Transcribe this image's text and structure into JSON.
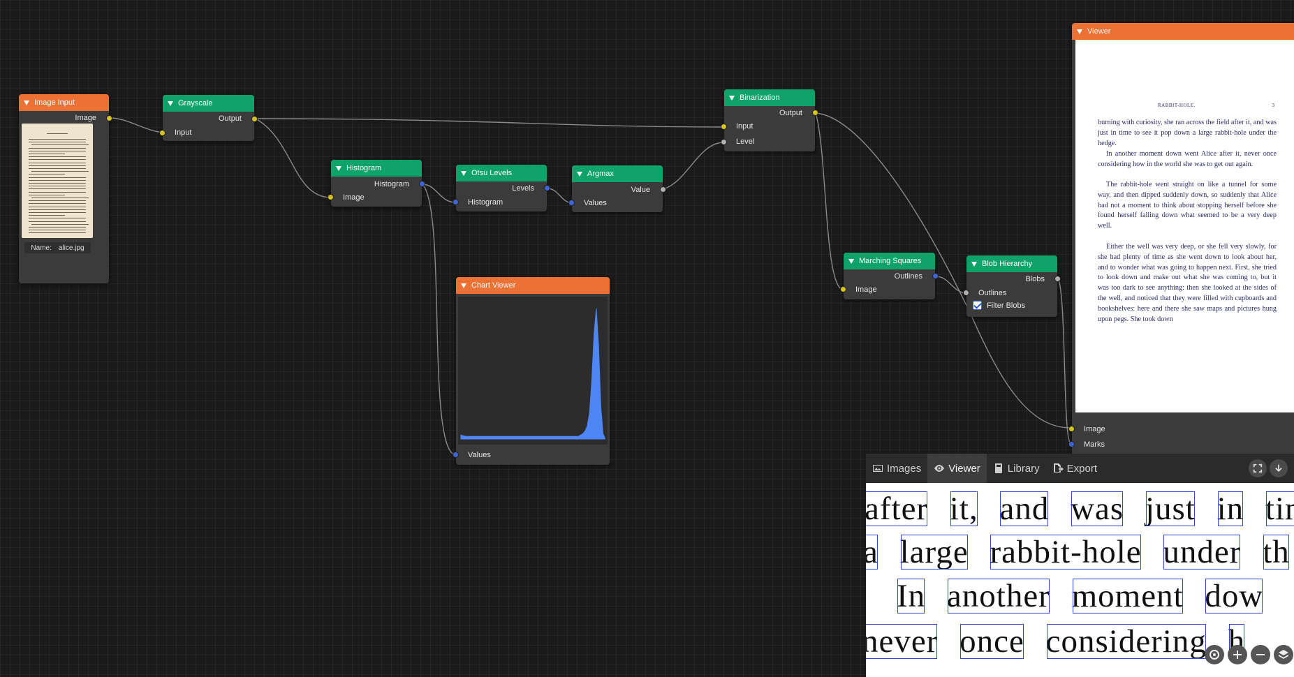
{
  "nodes": {
    "image_input": {
      "title": "Image Input",
      "output_label": "Image",
      "name_label": "Name:",
      "name_value": "alice.jpg"
    },
    "grayscale": {
      "title": "Grayscale",
      "output_label": "Output",
      "input_label": "Input"
    },
    "histogram": {
      "title": "Histogram",
      "output_label": "Histogram",
      "input_label": "Image"
    },
    "otsu": {
      "title": "Otsu Levels",
      "output_label": "Levels",
      "input_label": "Histogram"
    },
    "argmax": {
      "title": "Argmax",
      "output_label": "Value",
      "input_label": "Values"
    },
    "binarization": {
      "title": "Binarization",
      "output_label": "Output",
      "input_label": "Input",
      "level_label": "Level"
    },
    "chart_viewer": {
      "title": "Chart Viewer",
      "input_label": "Values"
    },
    "marching_squares": {
      "title": "Marching Squares",
      "output_label": "Outlines",
      "input_label": "Image"
    },
    "blob_hierarchy": {
      "title": "Blob Hierarchy",
      "output_label": "Blobs",
      "input_label": "Outlines",
      "checkbox_label": "Filter Blobs",
      "checkbox_checked": true
    },
    "viewer": {
      "title": "Viewer",
      "image_label": "Image",
      "marks_label": "Marks"
    }
  },
  "document": {
    "header_title": "RABBIT-HOLE.",
    "page_number": "3",
    "paragraphs": [
      "burning with curiosity, she ran across the field after it, and was just in time to see it pop down a large rabbit-hole under the hedge.",
      "In another moment down went Alice after it, never once considering how in the world she was to get out again.",
      "The rabbit-hole went straight on like a tunnel for some way, and then dipped suddenly down, so suddenly that Alice had not a moment to think about stopping herself before she found herself falling down what seemed to be a very deep well.",
      "Either the well was very deep, or she fell very slowly, for she had plenty of time as she went down to look about her, and to wonder what was going to happen next. First, she tried to look down and make out what she was coming to, but it was too dark to see anything: then she looked at the sides of the well, and noticed that they were filled with cupboards and bookshelves: here and there she saw maps and pictures hung upon pegs. She took down"
    ]
  },
  "panel": {
    "tabs": [
      {
        "label": "Images",
        "icon": "image-icon",
        "active": false
      },
      {
        "label": "Viewer",
        "icon": "eye-icon",
        "active": true
      },
      {
        "label": "Library",
        "icon": "book-icon",
        "active": false
      },
      {
        "label": "Export",
        "icon": "export-icon",
        "active": false
      }
    ],
    "zoom_lines": [
      [
        "after",
        "it,",
        "and",
        "was",
        "just",
        "in",
        "tim"
      ],
      [
        "a",
        "large",
        "rabbit-hole",
        "under",
        "th"
      ],
      [
        "In",
        "another",
        "moment",
        "dow"
      ],
      [
        "never",
        "once",
        "considering",
        "h"
      ]
    ]
  },
  "chart_data": {
    "type": "area",
    "title": "",
    "xlabel": "",
    "ylabel": "",
    "x": [
      0,
      8,
      16,
      24,
      32,
      40,
      48,
      56,
      64,
      72,
      80,
      88,
      96,
      104,
      112,
      120,
      128,
      136,
      144,
      152,
      160,
      168,
      176,
      184,
      192,
      200,
      208,
      212,
      216,
      220,
      224,
      228,
      232,
      236,
      240,
      244,
      248,
      252,
      255
    ],
    "values": [
      0.03,
      0.02,
      0.02,
      0.02,
      0.02,
      0.02,
      0.02,
      0.02,
      0.02,
      0.02,
      0.02,
      0.02,
      0.02,
      0.02,
      0.02,
      0.02,
      0.02,
      0.02,
      0.02,
      0.02,
      0.02,
      0.02,
      0.02,
      0.02,
      0.02,
      0.02,
      0.02,
      0.03,
      0.04,
      0.06,
      0.1,
      0.2,
      0.45,
      0.8,
      1.0,
      0.72,
      0.25,
      0.04,
      0.01
    ],
    "series_color": "#4e86f5",
    "xlim": [
      0,
      255
    ],
    "ylim": [
      0,
      1.05
    ],
    "grid": false
  },
  "colors": {
    "node_green": "#0fa36a",
    "node_orange": "#ec7134",
    "port_yellow": "#d4c41b",
    "port_blue": "#3f65d6",
    "wire": "#8a8a8a"
  }
}
